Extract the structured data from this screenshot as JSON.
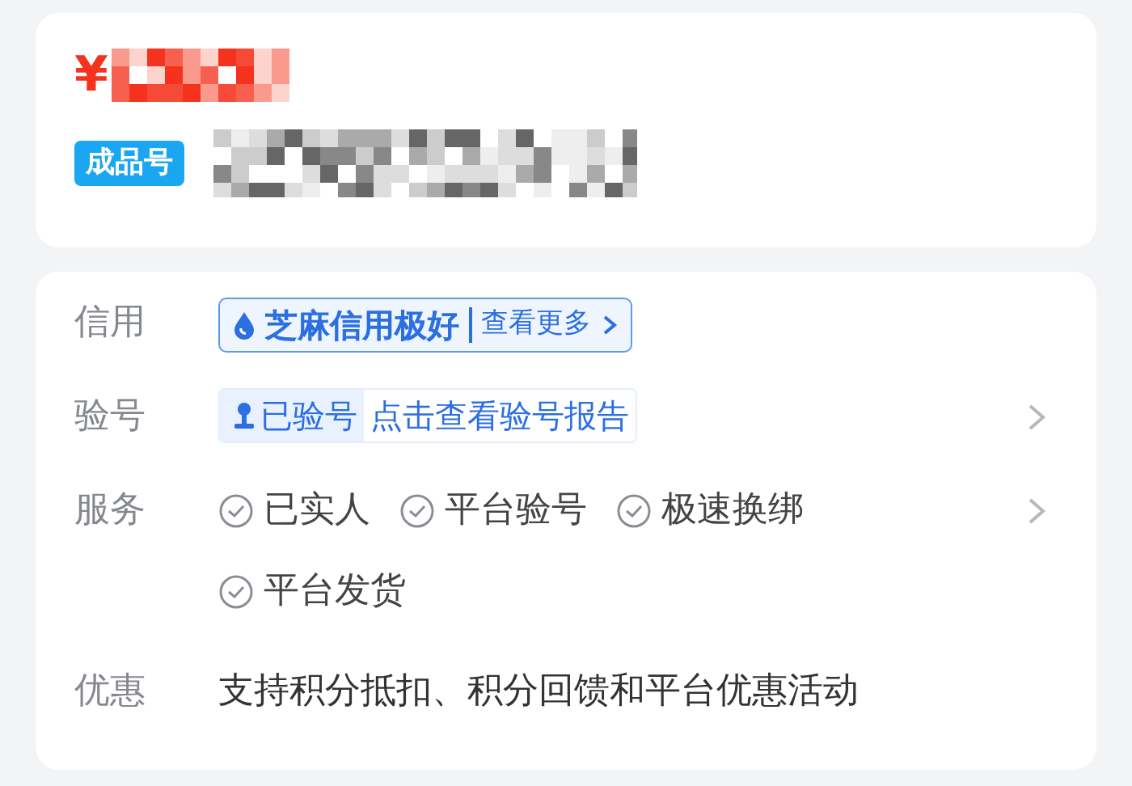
{
  "product": {
    "currency": "¥",
    "tag": "成品号"
  },
  "details": [
    {
      "kind": "credit",
      "label": "信用",
      "badge": "芝麻信用极好",
      "link": "查看更多",
      "has_arrow": false
    },
    {
      "kind": "verify",
      "label": "验号",
      "status": "已验号",
      "link": "点击查看验号报告",
      "has_arrow": true
    },
    {
      "kind": "services",
      "label": "服务",
      "items": [
        "已实人",
        "平台验号",
        "极速换绑",
        "平台发货"
      ],
      "has_arrow": true
    },
    {
      "kind": "text",
      "label": "优惠",
      "text": "支持积分抵扣、积分回馈和平台优惠活动",
      "has_arrow": false
    }
  ]
}
